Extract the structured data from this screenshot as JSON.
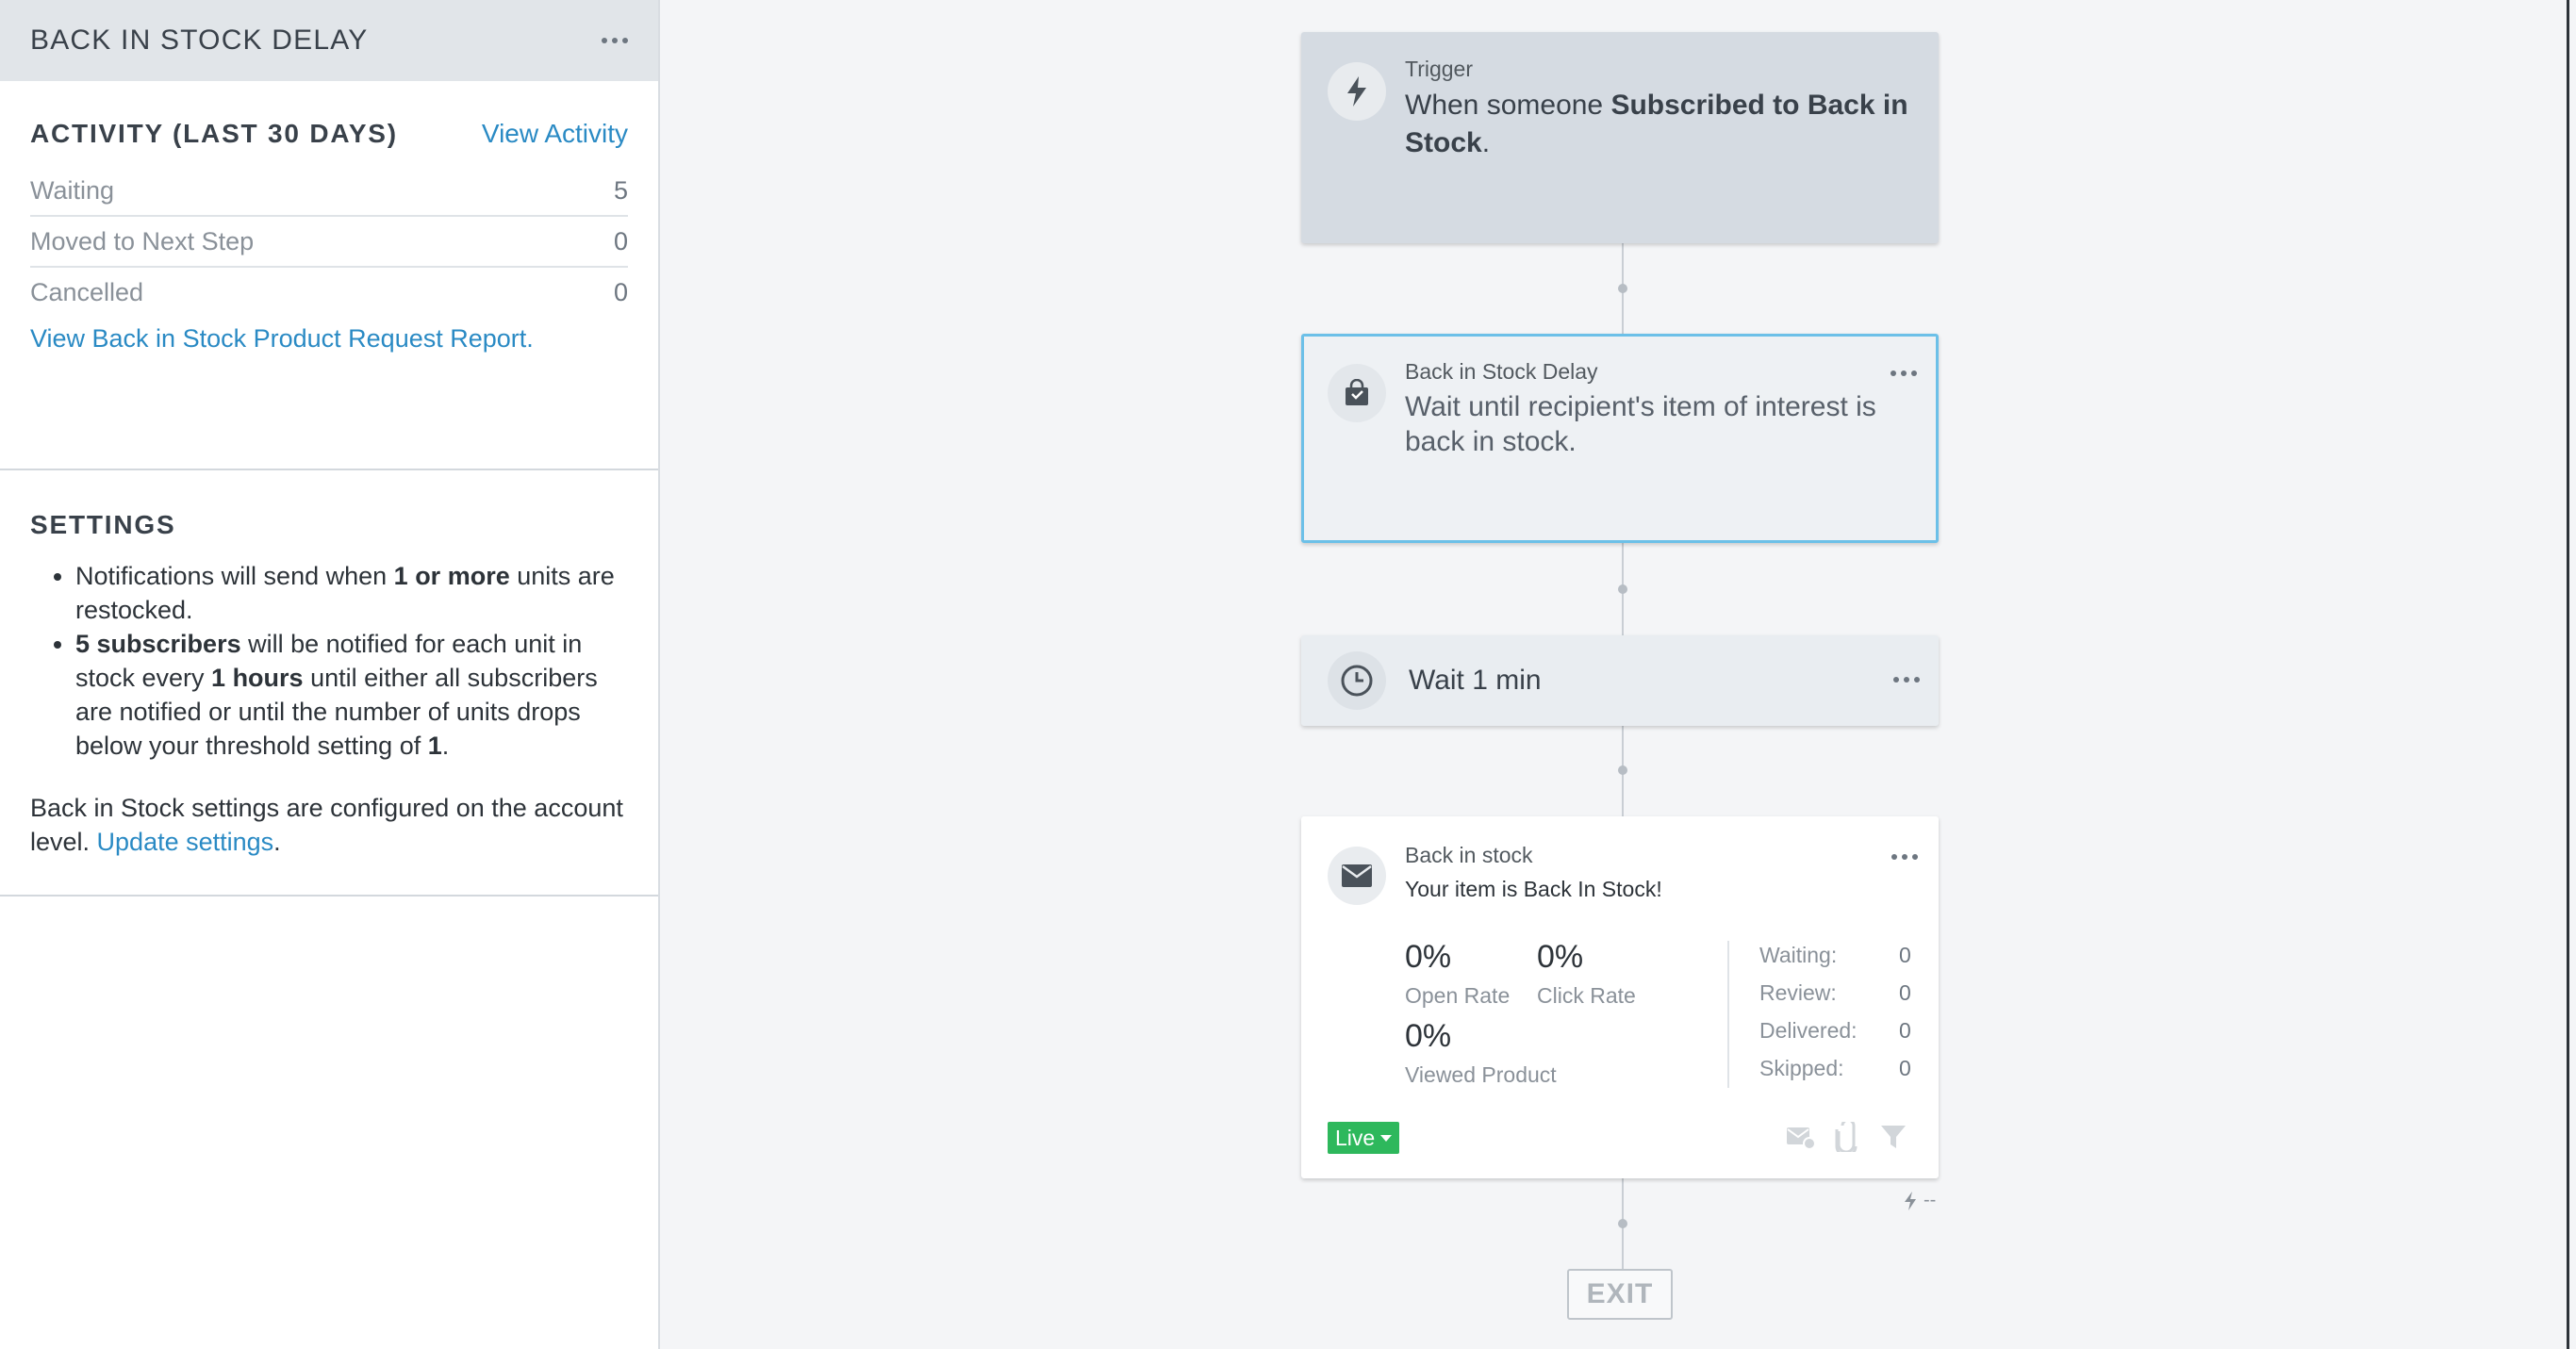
{
  "sidebar": {
    "title": "BACK IN STOCK DELAY",
    "activity": {
      "title": "ACTIVITY (LAST 30 DAYS)",
      "view_link": "View Activity",
      "rows": [
        {
          "label": "Waiting",
          "value": "5"
        },
        {
          "label": "Moved to Next Step",
          "value": "0"
        },
        {
          "label": "Cancelled",
          "value": "0"
        }
      ],
      "report_link": "View Back in Stock Product Request Report."
    },
    "settings": {
      "title": "SETTINGS",
      "b1_pre": "Notifications will send when ",
      "b1_bold": "1 or more",
      "b1_post": " units are restocked.",
      "b2_bold1": "5 subscribers",
      "b2_mid1": " will be notified for each unit in stock every ",
      "b2_bold2": "1 hours",
      "b2_mid2": " until either all subscribers are notified or until the number of units drops below your threshold setting of ",
      "b2_bold3": "1",
      "b2_end": ".",
      "note_pre": "Back in Stock settings are configured on the account level. ",
      "note_link": "Update settings",
      "note_end": "."
    }
  },
  "flow": {
    "trigger": {
      "label": "Trigger",
      "text_pre": "When someone ",
      "text_bold": "Subscribed to Back in Stock",
      "text_end": "."
    },
    "delay": {
      "label": "Back in Stock Delay",
      "text": "Wait until recipient's item of interest is back in stock."
    },
    "wait": {
      "text": "Wait 1 min"
    },
    "email": {
      "label": "Back in stock",
      "subject": "Your item is Back In Stock!",
      "open_rate": "0%",
      "open_rate_label": "Open Rate",
      "click_rate": "0%",
      "click_rate_label": "Click Rate",
      "viewed": "0%",
      "viewed_label": "Viewed Product",
      "stats": [
        {
          "label": "Waiting:",
          "value": "0"
        },
        {
          "label": "Review:",
          "value": "0"
        },
        {
          "label": "Delivered:",
          "value": "0"
        },
        {
          "label": "Skipped:",
          "value": "0"
        }
      ],
      "status": "Live",
      "trigger_meta": "--"
    },
    "exit": "EXIT"
  },
  "colors": {
    "accent": "#2a8ac4",
    "live": "#2eb85c",
    "selected_border": "#6cc0e8"
  }
}
